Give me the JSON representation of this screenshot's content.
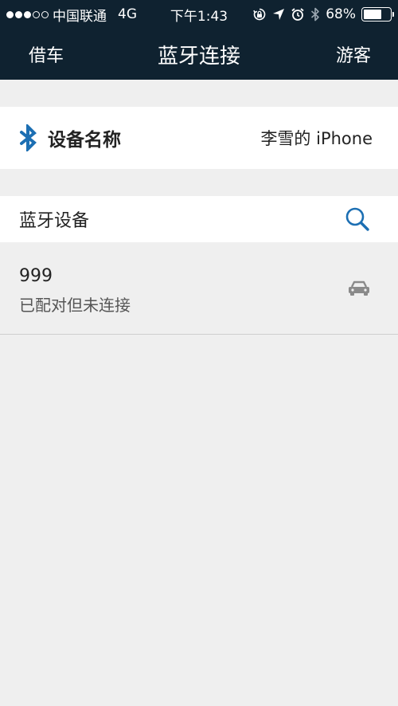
{
  "status_bar": {
    "carrier": "中国联通",
    "network": "4G",
    "time": "下午1:43",
    "battery_percent": "68%",
    "battery_level": 0.68,
    "signal_bars_filled": 3,
    "signal_bars_total": 5
  },
  "nav": {
    "left_label": "借车",
    "title": "蓝牙连接",
    "right_label": "游客"
  },
  "device_name_row": {
    "label": "设备名称",
    "value": "李雪的 iPhone",
    "icon": "bluetooth-icon"
  },
  "bluetooth_devices": {
    "header": "蓝牙设备",
    "search_icon": "search-icon",
    "items": [
      {
        "name": "999",
        "status": "已配对但未连接",
        "icon": "car-icon"
      }
    ]
  },
  "colors": {
    "bar_background": "#0f2230",
    "accent_blue": "#1c6fb3",
    "page_background": "#efefef",
    "icon_gray": "#8a8a8a"
  }
}
